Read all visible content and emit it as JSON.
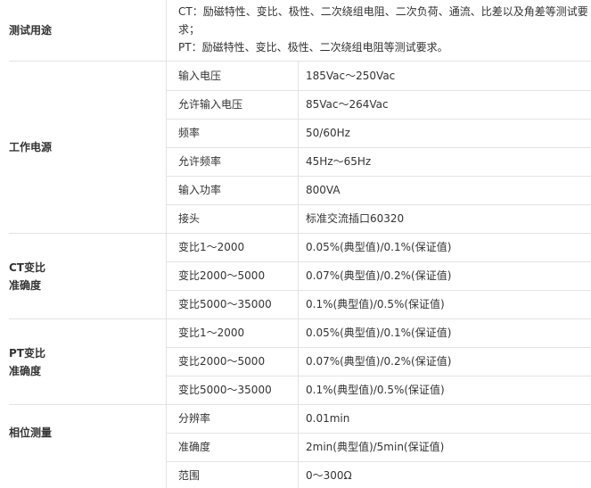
{
  "sections": {
    "purpose": {
      "label": "测试用途",
      "lines": [
        "CT：励磁特性、变比、极性、二次绕组电阻、二次负荷、通流、比差以及角差等测试要",
        "求；",
        "PT：励磁特性、变比、极性、二次绕组电阻等测试要求。"
      ]
    },
    "power": {
      "label": "工作电源",
      "rows": [
        {
          "param": "输入电压",
          "value": "185Vac～250Vac"
        },
        {
          "param": "允许输入电压",
          "value": "85Vac～264Vac"
        },
        {
          "param": "频率",
          "value": "50/60Hz"
        },
        {
          "param": "允许频率",
          "value": "45Hz～65Hz"
        },
        {
          "param": "输入功率",
          "value": "800VA"
        },
        {
          "param": "接头",
          "value": "标准交流插口60320"
        }
      ]
    },
    "ct": {
      "label_line1": "CT变比",
      "label_line2": "准确度",
      "rows": [
        {
          "param": "变比1～2000",
          "value": "0.05%(典型值)/0.1%(保证值)"
        },
        {
          "param": "变比2000～5000",
          "value": "0.07%(典型值)/0.2%(保证值)"
        },
        {
          "param": "变比5000～35000",
          "value": "0.1%(典型值)/0.5%(保证值)"
        }
      ]
    },
    "pt": {
      "label_line1": "PT变比",
      "label_line2": "准确度",
      "rows": [
        {
          "param": "变比1～2000",
          "value": "0.05%(典型值)/0.1%(保证值)"
        },
        {
          "param": "变比2000～5000",
          "value": "0.07%(典型值)/0.2%(保证值)"
        },
        {
          "param": "变比5000～35000",
          "value": "0.1%(典型值)/0.5%(保证值)"
        }
      ]
    },
    "phase": {
      "label": "相位测量",
      "rows": [
        {
          "param": "分辨率",
          "value": "0.01min"
        },
        {
          "param": "准确度",
          "value": "2min(典型值)/5min(保证值)"
        },
        {
          "param": "范围",
          "value": "0～300Ω"
        }
      ]
    }
  }
}
